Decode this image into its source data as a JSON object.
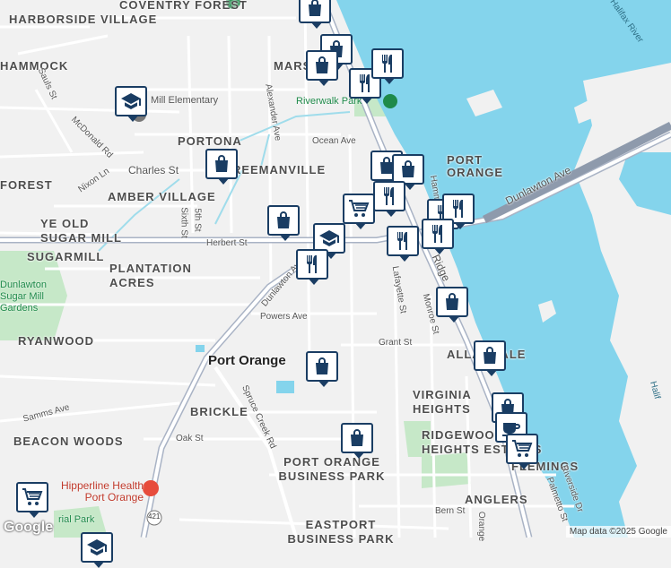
{
  "map": {
    "areas": [
      "COVENTRY FOREST",
      "HARBORSIDE VILLAGE",
      "HAMMOCK",
      "MARS",
      "PORTONA",
      "FOREST",
      "FREEMANVILLE",
      "AMBER VILLAGE",
      "YE OLD SUGAR MILL",
      "SUGARMILL",
      "PLANTATION ACRES",
      "RYANWOOD",
      "PORT ORANGE",
      "ALLANDALE",
      "VIRGINIA HEIGHTS",
      "BRICKLE",
      "BEACON WOODS",
      "RIDGEWOOD HEIGHTS ESTATES",
      "PORT ORANGE BUSINESS PARK",
      "FLEMINGS",
      "ANGLERS",
      "EASTPORT BUSINESS PARK"
    ],
    "streets": [
      "Sauls St",
      "McDonald Rd",
      "Nixon Ln",
      "Charles St",
      "Alexander Ave",
      "Ocean Ave",
      "Sixth St",
      "5th St",
      "Herbert St",
      "Dunlawton Ave",
      "Lafayette St",
      "Monroe St",
      "Ridge",
      "Powers Ave",
      "Grant St",
      "Spruce Creek Rd",
      "Samms Ave",
      "Oak St",
      "Bern St",
      "Palmetto St",
      "Riverside Dr",
      "Dunlawton Ave",
      "Hamm",
      "Orange"
    ],
    "city": "Port Orange",
    "water_labels": [
      "Halifax River",
      "Halif"
    ],
    "pois": {
      "school": "Mill Elementary",
      "park": "Riverwalk Park",
      "health": "Hipperline Health Port Orange",
      "gardens": "Dunlawton Sugar Mill Gardens",
      "rial_park": "rial Park"
    },
    "route_shield": "421",
    "attribution": "Map data ©2025 Google",
    "logo": "Google"
  },
  "markers": [
    {
      "icon": "shopping-bag-icon"
    },
    {
      "icon": "shopping-bag-icon"
    },
    {
      "icon": "shopping-bag-icon"
    },
    {
      "icon": "restaurant-icon"
    },
    {
      "icon": "restaurant-icon"
    },
    {
      "icon": "school-icon"
    },
    {
      "icon": "shopping-bag-icon"
    },
    {
      "icon": "shopping-bag-icon"
    },
    {
      "icon": "shopping-bag-icon"
    },
    {
      "icon": "restaurant-icon"
    },
    {
      "icon": "shopping-cart-icon"
    },
    {
      "icon": "restaurant-icon"
    },
    {
      "icon": "restaurant-icon"
    },
    {
      "icon": "shopping-bag-icon"
    },
    {
      "icon": "school-icon"
    },
    {
      "icon": "restaurant-icon"
    },
    {
      "icon": "restaurant-icon"
    },
    {
      "icon": "restaurant-icon"
    },
    {
      "icon": "shopping-bag-icon"
    },
    {
      "icon": "shopping-bag-icon"
    },
    {
      "icon": "shopping-bag-icon"
    },
    {
      "icon": "shopping-bag-icon"
    },
    {
      "icon": "shopping-bag-icon"
    },
    {
      "icon": "coffee-icon"
    },
    {
      "icon": "shopping-cart-icon"
    },
    {
      "icon": "shopping-cart-icon"
    },
    {
      "icon": "school-icon"
    }
  ],
  "colors": {
    "water": "#84d4ec",
    "park": "#c6e8c8",
    "road": "#ffffff",
    "arterial": "#a9b3c5",
    "marker_border": "#1a3d63",
    "marker_bg": "#ffffff"
  }
}
